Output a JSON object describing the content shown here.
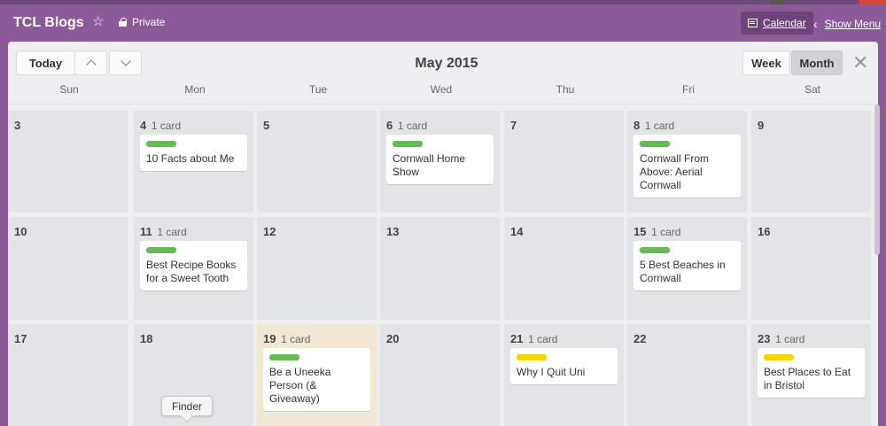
{
  "header": {
    "board_title": "TCL Blogs",
    "privacy": "Private",
    "calendar_label": "Calendar",
    "show_menu_label": "Show Menu"
  },
  "toolbar": {
    "today_label": "Today",
    "title": "May 2015",
    "week_label": "Week",
    "month_label": "Month",
    "active_view": "Month"
  },
  "days_of_week": [
    "Sun",
    "Mon",
    "Tue",
    "Wed",
    "Thu",
    "Fri",
    "Sat"
  ],
  "weeks": [
    [
      {
        "day": "3",
        "count": "",
        "cards": []
      },
      {
        "day": "4",
        "count": "1 card",
        "cards": [
          {
            "title": "10 Facts about Me",
            "label_color": "#61bd4f"
          }
        ]
      },
      {
        "day": "5",
        "count": "",
        "cards": []
      },
      {
        "day": "6",
        "count": "1 card",
        "cards": [
          {
            "title": "Cornwall Home Show",
            "label_color": "#61bd4f"
          }
        ]
      },
      {
        "day": "7",
        "count": "",
        "cards": []
      },
      {
        "day": "8",
        "count": "1 card",
        "cards": [
          {
            "title": "Cornwall From Above: Aerial Cornwall",
            "label_color": "#61bd4f"
          }
        ]
      },
      {
        "day": "9",
        "count": "",
        "cards": []
      }
    ],
    [
      {
        "day": "10",
        "count": "",
        "cards": []
      },
      {
        "day": "11",
        "count": "1 card",
        "cards": [
          {
            "title": "Best Recipe Books for a Sweet Tooth",
            "label_color": "#61bd4f"
          }
        ]
      },
      {
        "day": "12",
        "count": "",
        "cards": []
      },
      {
        "day": "13",
        "count": "",
        "cards": []
      },
      {
        "day": "14",
        "count": "",
        "cards": []
      },
      {
        "day": "15",
        "count": "1 card",
        "cards": [
          {
            "title": "5 Best Beaches in Cornwall",
            "label_color": "#61bd4f"
          }
        ]
      },
      {
        "day": "16",
        "count": "",
        "cards": []
      }
    ],
    [
      {
        "day": "17",
        "count": "",
        "cards": []
      },
      {
        "day": "18",
        "count": "",
        "cards": []
      },
      {
        "day": "19",
        "count": "1 card",
        "today": true,
        "cards": [
          {
            "title": "Be a Uneeka Person (& Giveaway)",
            "label_color": "#61bd4f"
          }
        ]
      },
      {
        "day": "20",
        "count": "",
        "cards": []
      },
      {
        "day": "21",
        "count": "1 card",
        "cards": [
          {
            "title": "Why I Quit Uni",
            "label_color": "#f2d600"
          }
        ]
      },
      {
        "day": "22",
        "count": "",
        "cards": []
      },
      {
        "day": "23",
        "count": "1 card",
        "cards": [
          {
            "title": "Best Places to Eat in Bristol",
            "label_color": "#f2d600"
          }
        ]
      }
    ]
  ],
  "tooltip": "Finder",
  "colors": {
    "board_bg": "#8b5a99",
    "label_green": "#61bd4f",
    "label_yellow": "#f2d600",
    "today_bg": "#f2e8d6"
  }
}
